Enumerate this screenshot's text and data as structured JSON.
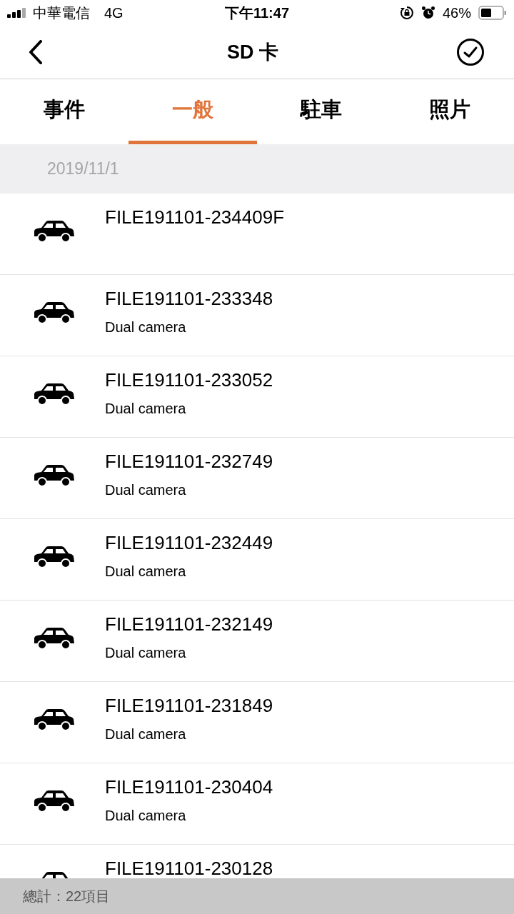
{
  "status_bar": {
    "carrier": "中華電信",
    "network": "4G",
    "time": "下午11:47",
    "battery": "46%"
  },
  "nav": {
    "title": "SD 卡"
  },
  "tabs": [
    {
      "label": "事件",
      "selected": false
    },
    {
      "label": "一般",
      "selected": true
    },
    {
      "label": "駐車",
      "selected": false
    },
    {
      "label": "照片",
      "selected": false
    }
  ],
  "section": {
    "date": "2019/11/1"
  },
  "files": [
    {
      "name": "FILE191101-234409F"
    },
    {
      "name": "FILE191101-233348",
      "detail": "Dual camera"
    },
    {
      "name": "FILE191101-233052",
      "detail": "Dual camera"
    },
    {
      "name": "FILE191101-232749",
      "detail": "Dual camera"
    },
    {
      "name": "FILE191101-232449",
      "detail": "Dual camera"
    },
    {
      "name": "FILE191101-232149",
      "detail": "Dual camera"
    },
    {
      "name": "FILE191101-231849",
      "detail": "Dual camera"
    },
    {
      "name": "FILE191101-230404",
      "detail": "Dual camera"
    },
    {
      "name": "FILE191101-230128"
    }
  ],
  "footer": {
    "total": "總計：22項目"
  }
}
